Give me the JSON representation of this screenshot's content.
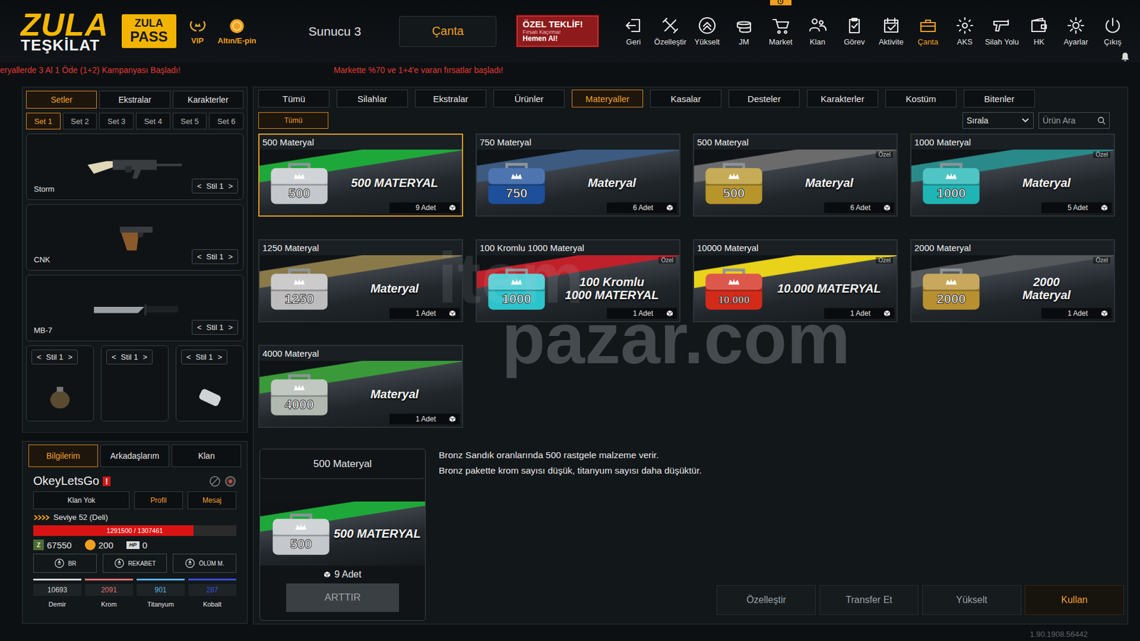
{
  "header": {
    "logo_top": "ZULA",
    "logo_bottom": "TEŞKİLAT",
    "pass_top": "ZULA",
    "pass_bottom": "PASS",
    "vip": "VIP",
    "gold": "Altın/E-pin",
    "server": "Sunucu 3",
    "bag_button": "Çanta",
    "offer": {
      "title": "ÖZEL TEKLİF!",
      "subtitle": "Fırsatı Kaçırma!",
      "cta": "Hemen Al!"
    },
    "nav": [
      {
        "label": "Geri",
        "selected": false,
        "badge": false
      },
      {
        "label": "Özelleştir",
        "selected": false,
        "badge": false
      },
      {
        "label": "Yükselt",
        "selected": false,
        "badge": false
      },
      {
        "label": "JM",
        "selected": false,
        "badge": false
      },
      {
        "label": "Market",
        "selected": false,
        "badge": true
      },
      {
        "label": "Klan",
        "selected": false,
        "badge": false
      },
      {
        "label": "Görev",
        "selected": false,
        "badge": false
      },
      {
        "label": "Aktivite",
        "selected": false,
        "badge": false
      },
      {
        "label": "Çanta",
        "selected": true,
        "badge": false
      },
      {
        "label": "AKS",
        "selected": false,
        "badge": false
      },
      {
        "label": "Silah Yolu",
        "selected": false,
        "badge": false
      },
      {
        "label": "HK",
        "selected": false,
        "badge": false
      },
      {
        "label": "Ayarlar",
        "selected": false,
        "badge": false
      },
      {
        "label": "Çıkış",
        "selected": false,
        "badge": false
      }
    ]
  },
  "ticker": [
    "eryallerde 3 Al 1 Öde (1+2) Kampanyası Başladı!",
    "Markette %70 ve 1+4'e varan fırsatlar başladı!"
  ],
  "loadout": {
    "tabs": [
      {
        "label": "Setler",
        "selected": true
      },
      {
        "label": "Ekstralar",
        "selected": false
      },
      {
        "label": "Karakterler",
        "selected": false
      }
    ],
    "sets": [
      {
        "label": "Set 1",
        "selected": true
      },
      {
        "label": "Set 2",
        "selected": false
      },
      {
        "label": "Set 3",
        "selected": false
      },
      {
        "label": "Set 4",
        "selected": false
      },
      {
        "label": "Set 5",
        "selected": false
      },
      {
        "label": "Set 6",
        "selected": false
      }
    ],
    "arrows": [
      "<",
      ">"
    ],
    "weapons": [
      {
        "name": "Storm",
        "style": "Stil 1",
        "kind": "rifle"
      },
      {
        "name": "CNK",
        "style": "Stil 1",
        "kind": "pistol"
      },
      {
        "name": "MB-7",
        "style": "Stil 1",
        "kind": "knife"
      }
    ],
    "slots": [
      {
        "style": "Stil 1",
        "kind": "grenade"
      },
      {
        "style": "Stil 1",
        "kind": "empty"
      },
      {
        "style": "Stil 1",
        "kind": "smoke"
      }
    ]
  },
  "profile": {
    "tabs": [
      {
        "label": "Bilgilerim",
        "selected": true
      },
      {
        "label": "Arkadaşlarım",
        "selected": false
      },
      {
        "label": "Klan",
        "selected": false
      }
    ],
    "name": "OkeyLetsGo",
    "flag": "!",
    "buttons": [
      {
        "label": "Klan Yok",
        "accent": false
      },
      {
        "label": "Profil",
        "accent": true
      },
      {
        "label": "Mesaj",
        "accent": true
      }
    ],
    "rank": "Seviye 52 (Deli)",
    "xp": {
      "text": "1291500 / 1307461",
      "level": 0.79
    },
    "currencies": [
      {
        "value": "67550",
        "kind": "zula",
        "icon": "Z"
      },
      {
        "value": "200",
        "kind": "gold",
        "icon": ""
      },
      {
        "value": "0",
        "kind": "hp",
        "icon": "HP"
      }
    ],
    "modes": [
      "BR",
      "REKABET",
      "ÖLÜM M."
    ],
    "resources": [
      {
        "value": "10693",
        "label": "Demir",
        "color": "#d8d8d8"
      },
      {
        "value": "2091",
        "label": "Krom",
        "color": "#e07474"
      },
      {
        "value": "901",
        "label": "Titanyum",
        "color": "#5ab4e6"
      },
      {
        "value": "287",
        "label": "Kobalt",
        "color": "#3a4ee0"
      }
    ]
  },
  "market": {
    "categories": [
      {
        "label": "Tümü",
        "selected": false
      },
      {
        "label": "Silahlar",
        "selected": false
      },
      {
        "label": "Ekstralar",
        "selected": false
      },
      {
        "label": "Ürünler",
        "selected": false
      },
      {
        "label": "Materyaller",
        "selected": true
      },
      {
        "label": "Kasalar",
        "selected": false
      },
      {
        "label": "Desteler",
        "selected": false
      },
      {
        "label": "Karakterler",
        "selected": false
      },
      {
        "label": "Kostüm",
        "selected": false
      },
      {
        "label": "Bitenler",
        "selected": false
      }
    ],
    "subtabs": [
      {
        "label": "Tümü",
        "selected": true
      }
    ],
    "sort": "Sırala",
    "search_placeholder": "Ürün Ara",
    "items": [
      {
        "title": "500 Materyal",
        "number": "500",
        "labels": [
          "500 MATERYAL"
        ],
        "count": "9 Adet",
        "badge": "",
        "color": "#c4c8cc",
        "stripe": "#1fa83a",
        "selected": true
      },
      {
        "title": "750 Materyal",
        "number": "750",
        "labels": [
          "Materyal"
        ],
        "count": "6 Adet",
        "badge": "",
        "color": "#1d4f9a",
        "stripe": "#3d5a80",
        "selected": false
      },
      {
        "title": "500 Materyal",
        "number": "500",
        "labels": [
          "Materyal"
        ],
        "count": "6 Adet",
        "badge": "Özel",
        "color": "#b8952a",
        "stripe": "#6b6b6b",
        "selected": false
      },
      {
        "title": "1000 Materyal",
        "number": "1000",
        "labels": [
          "Materyal"
        ],
        "count": "5 Adet",
        "badge": "Özel",
        "color": "#1fb5b5",
        "stripe": "#2a8a8a",
        "selected": false
      },
      {
        "title": "1250 Materyal",
        "number": "1250",
        "labels": [
          "Materyal"
        ],
        "count": "1 Adet",
        "badge": "",
        "color": "#bdbdbd",
        "stripe": "#8a7a4a",
        "selected": false
      },
      {
        "title": "100 Kromlu 1000 Materyal",
        "number": "1000",
        "labels": [
          "100 Kromlu",
          "1000 MATERYAL"
        ],
        "count": "1 Adet",
        "badge": "Özel",
        "color": "#2cc4cc",
        "stripe": "#c0202a",
        "selected": false
      },
      {
        "title": "10000 Materyal",
        "number": "10.000",
        "labels": [
          "10.000 MATERYAL"
        ],
        "count": "1 Adet",
        "badge": "Özel",
        "color": "#d42a1a",
        "stripe": "#e8d21a",
        "selected": false
      },
      {
        "title": "2000 Materyal",
        "number": "2000",
        "labels": [
          "2000",
          "Materyal"
        ],
        "count": "1 Adet",
        "badge": "Özel",
        "color": "#b89030",
        "stripe": "#55595c",
        "selected": false
      },
      {
        "title": "4000 Materyal",
        "number": "4000",
        "labels": [
          "Materyal"
        ],
        "count": "1 Adet",
        "badge": "",
        "color": "#b0b8b0",
        "stripe": "#3a9a3a",
        "selected": false
      }
    ]
  },
  "detail": {
    "title": "500 Materyal",
    "number": "500",
    "labels": [
      "500 MATERYAL"
    ],
    "color": "#c4c8cc",
    "stripe": "#1fa83a",
    "count": "9 Adet",
    "increase": "ARTTIR",
    "increase_disabled": true,
    "description": [
      "Bronz Sandık oranlarında 500 rastgele malzeme verir.",
      "Bronz pakette krom sayısı düşük, titanyum sayısı daha düşüktür."
    ],
    "actions": [
      {
        "label": "Özelleştir",
        "primary": false
      },
      {
        "label": "Transfer Et",
        "primary": false
      },
      {
        "label": "Yükselt",
        "primary": false
      },
      {
        "label": "Kullan",
        "primary": true
      }
    ]
  },
  "watermark": [
    "item",
    "pazar.com"
  ],
  "version": "1.90.1908.56442"
}
